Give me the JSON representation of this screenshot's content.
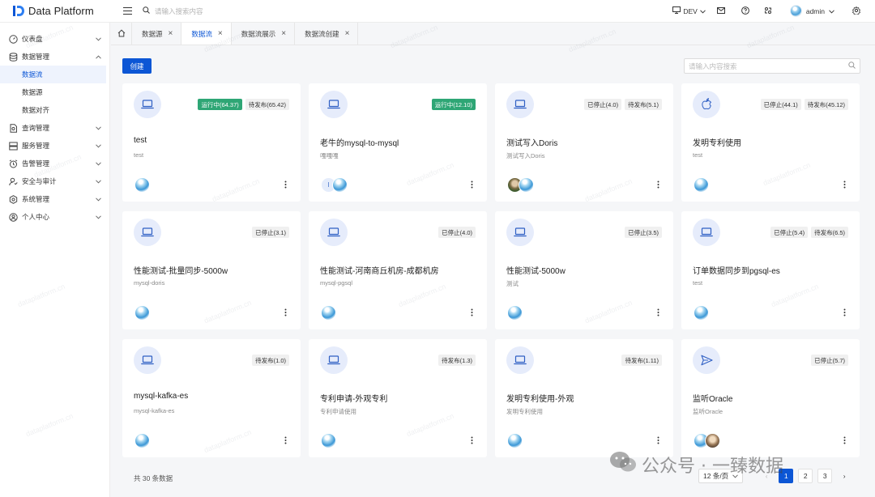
{
  "app": {
    "title": "Data Platform"
  },
  "header": {
    "search_placeholder": "请输入搜索内容",
    "env": "DEV",
    "user": "admin"
  },
  "sidebar": {
    "items": [
      {
        "label": "仪表盘",
        "icon": "dashboard-icon"
      },
      {
        "label": "数据管理",
        "icon": "database-icon",
        "expanded": true,
        "children": [
          {
            "label": "数据流",
            "active": true
          },
          {
            "label": "数据源"
          },
          {
            "label": "数据对齐"
          }
        ]
      },
      {
        "label": "查询管理",
        "icon": "query-icon"
      },
      {
        "label": "服务管理",
        "icon": "server-icon"
      },
      {
        "label": "告警管理",
        "icon": "alarm-icon"
      },
      {
        "label": "安全与审计",
        "icon": "security-icon"
      },
      {
        "label": "系统管理",
        "icon": "system-icon"
      },
      {
        "label": "个人中心",
        "icon": "user-icon"
      }
    ]
  },
  "tabs": [
    {
      "label": "数据源",
      "active": false
    },
    {
      "label": "数据流",
      "active": true
    },
    {
      "label": "数据流展示",
      "active": false
    },
    {
      "label": "数据流创建",
      "active": false
    }
  ],
  "toolbar": {
    "create_label": "创建",
    "search_placeholder": "请输入内容搜索"
  },
  "cards": [
    {
      "title": "test",
      "desc": "test",
      "icon": "laptop-icon",
      "badges": [
        {
          "text": "运行中(64.37)",
          "kind": "running"
        },
        {
          "text": "待发布(65.42)",
          "kind": "gray"
        }
      ],
      "avatars": [
        "sky"
      ]
    },
    {
      "title": "老牛的mysql-to-mysql",
      "desc": "嘎嘎嘎",
      "icon": "laptop-icon",
      "badges": [
        {
          "text": "运行中(12.10)",
          "kind": "running"
        }
      ],
      "avatars": [
        "letter",
        "sky"
      ],
      "avatar_letter": "l"
    },
    {
      "title": "测试写入Doris",
      "desc": "测试写入Doris",
      "icon": "laptop-icon",
      "badges": [
        {
          "text": "已停止(4.0)",
          "kind": "gray"
        },
        {
          "text": "待发布(5.1)",
          "kind": "gray"
        }
      ],
      "avatars": [
        "photo",
        "sky"
      ]
    },
    {
      "title": "发明专利使用",
      "desc": "test",
      "icon": "apple-icon",
      "badges": [
        {
          "text": "已停止(44.1)",
          "kind": "gray"
        },
        {
          "text": "待发布(45.12)",
          "kind": "gray"
        }
      ],
      "avatars": [
        "sky"
      ]
    },
    {
      "title": "性能测试-批量同步-5000w",
      "desc": "mysql-doris",
      "icon": "laptop-icon",
      "badges": [
        {
          "text": "已停止(3.1)",
          "kind": "gray"
        }
      ],
      "avatars": [
        "sky"
      ]
    },
    {
      "title": "性能测试-河南商丘机房-成都机房",
      "desc": "mysql-pgsql",
      "icon": "laptop-icon",
      "badges": [
        {
          "text": "已停止(4.0)",
          "kind": "gray"
        }
      ],
      "avatars": [
        "sky"
      ]
    },
    {
      "title": "性能测试-5000w",
      "desc": "测试",
      "icon": "laptop-icon",
      "badges": [
        {
          "text": "已停止(3.5)",
          "kind": "gray"
        }
      ],
      "avatars": [
        "sky"
      ]
    },
    {
      "title": "订单数据同步到pgsql-es",
      "desc": "test",
      "icon": "laptop-icon",
      "badges": [
        {
          "text": "已停止(5.4)",
          "kind": "gray"
        },
        {
          "text": "待发布(6.5)",
          "kind": "gray"
        }
      ],
      "avatars": [
        "sky"
      ]
    },
    {
      "title": "mysql-kafka-es",
      "desc": "mysql-kafka-es",
      "icon": "laptop-icon",
      "badges": [
        {
          "text": "待发布(1.0)",
          "kind": "gray"
        }
      ],
      "avatars": [
        "sky"
      ]
    },
    {
      "title": "专利申请-外观专利",
      "desc": "专利申请使用",
      "icon": "laptop-icon",
      "badges": [
        {
          "text": "待发布(1.3)",
          "kind": "gray"
        }
      ],
      "avatars": [
        "sky"
      ]
    },
    {
      "title": "发明专利使用-外观",
      "desc": "发明专利使用",
      "icon": "laptop-icon",
      "badges": [
        {
          "text": "待发布(1.11)",
          "kind": "gray"
        }
      ],
      "avatars": [
        "sky"
      ]
    },
    {
      "title": "监听Oracle",
      "desc": "监听Oracle",
      "icon": "send-icon",
      "badges": [
        {
          "text": "已停止(5.7)",
          "kind": "gray"
        }
      ],
      "avatars": [
        "sky",
        "photo2"
      ]
    }
  ],
  "footer": {
    "total_text": "共 30 条数据"
  },
  "pagination": {
    "page_size": "12 条/页",
    "pages": [
      "1",
      "2",
      "3"
    ],
    "current": 1
  },
  "watermark": {
    "text": "dataplatform.cn",
    "brand": "公众号 · 一臻数据"
  },
  "colors": {
    "primary": "#0c56d5",
    "running": "#2ea675",
    "icon_bg": "#e6ecfb"
  }
}
